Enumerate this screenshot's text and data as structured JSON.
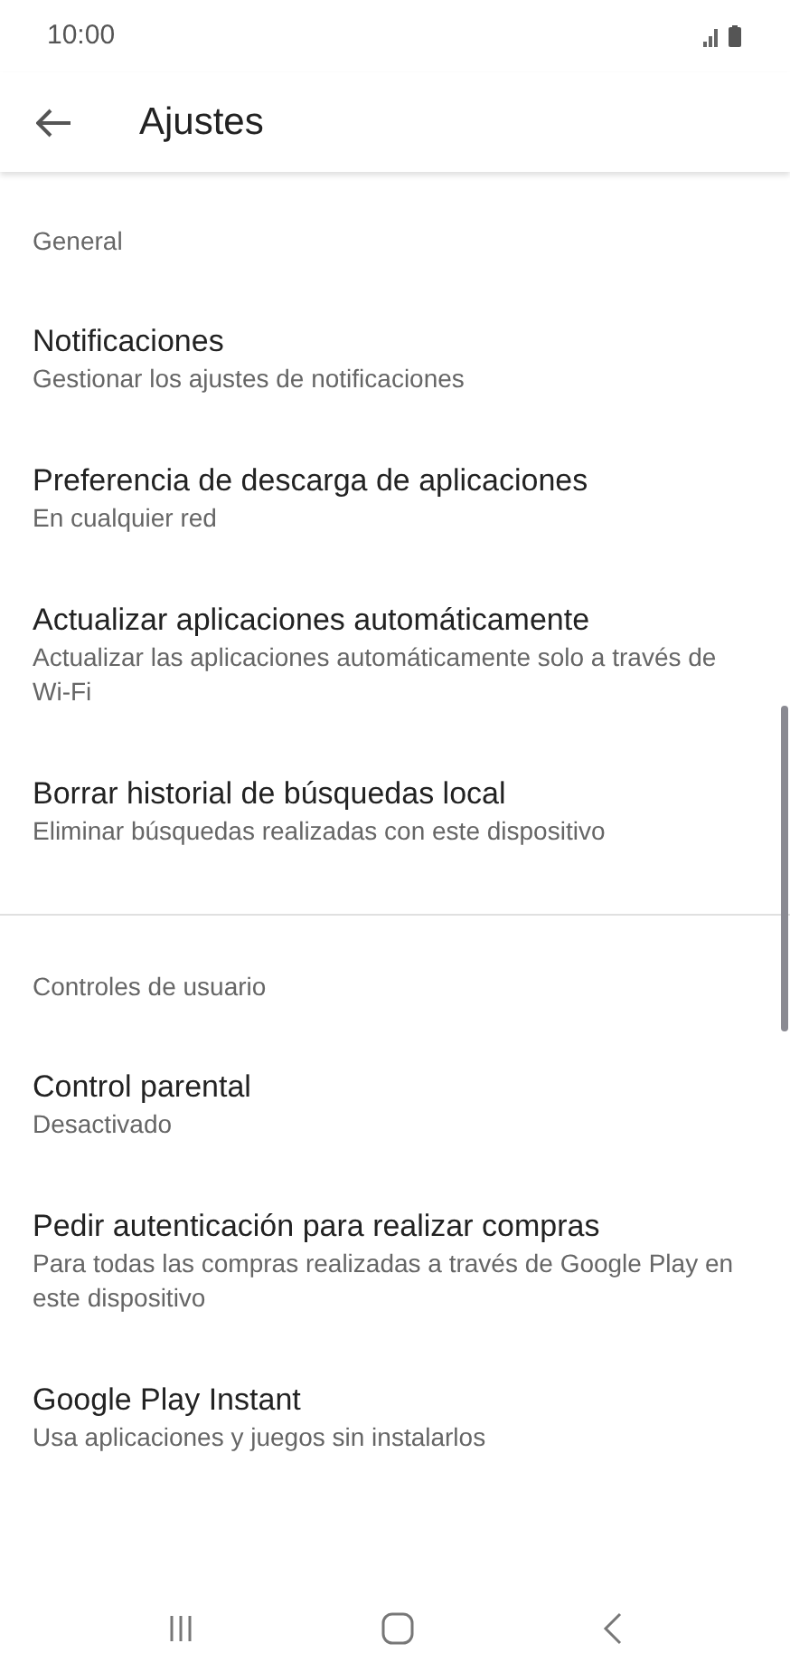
{
  "status_bar": {
    "time": "10:00"
  },
  "toolbar": {
    "title": "Ajustes"
  },
  "sections": [
    {
      "header": "General",
      "items": [
        {
          "title": "Notificaciones",
          "subtitle": "Gestionar los ajustes de notificaciones"
        },
        {
          "title": "Preferencia de descarga de aplicaciones",
          "subtitle": "En cualquier red"
        },
        {
          "title": "Actualizar aplicaciones automáticamente",
          "subtitle": "Actualizar las aplicaciones automáticamente solo a través de Wi-Fi"
        },
        {
          "title": "Borrar historial de búsquedas local",
          "subtitle": "Eliminar búsquedas realizadas con este dispositivo"
        }
      ]
    },
    {
      "header": "Controles de usuario",
      "items": [
        {
          "title": "Control parental",
          "subtitle": "Desactivado"
        },
        {
          "title": "Pedir autenticación para realizar compras",
          "subtitle": "Para todas las compras realizadas a través de Google Play en este dispositivo"
        },
        {
          "title": "Google Play Instant",
          "subtitle": "Usa aplicaciones y juegos sin instalarlos"
        }
      ]
    }
  ]
}
